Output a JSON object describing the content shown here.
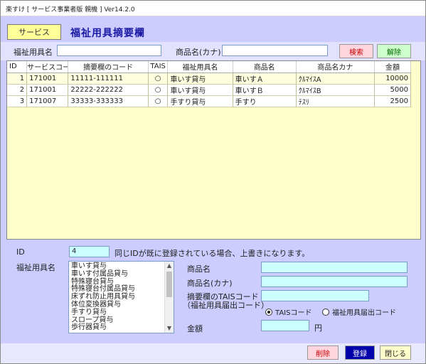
{
  "window": {
    "title": "楽すけ [ サービス事業者版 親機 ] Ver14.2.0"
  },
  "header": {
    "service_button": "サービス",
    "page_title": "福祉用具摘要欄"
  },
  "search": {
    "product_name_label": "福祉用具名",
    "product_name_value": "",
    "kana_label": "商品名(カナ)",
    "kana_value": "",
    "search_button": "検索",
    "clear_button": "解除"
  },
  "grid": {
    "columns": [
      "ID",
      "サービスコード",
      "摘要欄のコード",
      "TAIS",
      "福祉用具名",
      "商品名",
      "商品名カナ",
      "金額"
    ],
    "rows": [
      [
        "1",
        "171001",
        "11111-111111",
        "○",
        "車いす貸与",
        "車いすＡ",
        "ｸﾙﾏｲｽA",
        "10000"
      ],
      [
        "2",
        "171001",
        "22222-222222",
        "○",
        "車いす貸与",
        "車いすＢ",
        "ｸﾙﾏｲｽB",
        "5000"
      ],
      [
        "3",
        "171007",
        "33333-333333",
        "○",
        "手すり貸与",
        "手すり",
        "ﾃｽﾘ",
        "2500"
      ]
    ],
    "selected_row": 0
  },
  "form": {
    "id_label": "ID",
    "id_value": "4",
    "id_note": "同じIDが既に登録されている場合、上書きになります。",
    "welfare_label": "福祉用具名",
    "welfare_items": [
      "車いす貸与",
      "車いす付属品貸与",
      "特殊寝台貸与",
      "特殊寝台付属品貸与",
      "床ずれ防止用具貸与",
      "体位変換器貸与",
      "手すり貸与",
      "スロープ貸与",
      "歩行器貸与"
    ],
    "product_label": "商品名",
    "product_value": "",
    "kana_label": "商品名(カナ)",
    "kana_value": "",
    "tais_label_1": "摘要欄のTAISコード",
    "tais_label_2": "（福祉用具届出コード）",
    "tais_value": "",
    "radio_tais": "TAISコード",
    "radio_welfare": "福祉用具届出コード",
    "radio_selected": "tais",
    "price_label": "金額",
    "price_value": "",
    "price_unit": "円"
  },
  "footer": {
    "delete_button": "削除",
    "register_button": "登録",
    "close_button": "閉じる"
  },
  "colors": {
    "background": "#ccccff",
    "grid": "#ffffcc",
    "input_highlight": "#ccffff",
    "register": "#0000aa"
  }
}
